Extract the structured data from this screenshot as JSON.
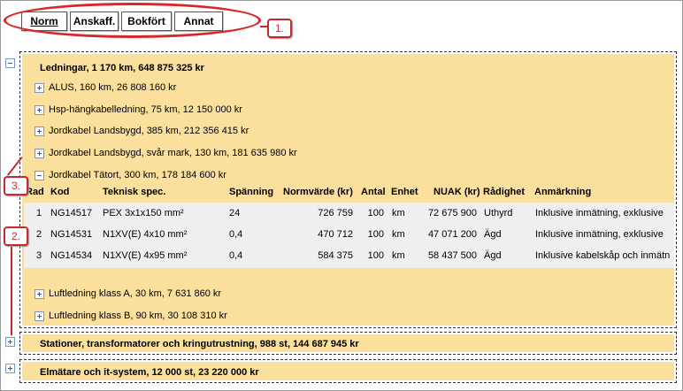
{
  "tabs": [
    {
      "label": "Norm",
      "active": true
    },
    {
      "label": "Anskaff.",
      "active": false
    },
    {
      "label": "Bokfört",
      "active": false
    },
    {
      "label": "Annat",
      "active": false
    }
  ],
  "callouts": {
    "one": "1.",
    "two": "2.",
    "three": "3."
  },
  "groups": {
    "ledningar": {
      "title": "Ledningar, 1 170 km, 648 875 325 kr",
      "expanded": true,
      "items": [
        "ALUS, 160 km, 26 808 160 kr",
        "Hsp-hängkabelledning, 75 km, 12 150 000 kr",
        "Jordkabel Landsbygd, 385 km, 212 356 415 kr",
        "Jordkabel Landsbygd, svår mark, 130 km, 181 635 980 kr",
        "Jordkabel Tätort, 300 km, 178 184 600 kr"
      ],
      "after_items": [
        "Luftledning klass A, 30 km, 7 631 860 kr",
        "Luftledning klass B, 90 km, 30 108 310 kr"
      ]
    },
    "stationer": {
      "title": "Stationer, transformatorer och kringutrustning, 988 st, 144 687 945 kr",
      "expanded": false
    },
    "elmatare": {
      "title": "Elmätare och it-system, 12 000 st, 23 220 000 kr",
      "expanded": false
    }
  },
  "table": {
    "headers": {
      "rad": "Rad",
      "kod": "Kod",
      "spec": "Teknisk spec.",
      "spanning": "Spänning",
      "normvarde": "Normvärde (kr)",
      "antal": "Antal",
      "enhet": "Enhet",
      "nuak": "NUAK (kr)",
      "radighet": "Rådighet",
      "anm": "Anmärkning"
    },
    "rows": [
      {
        "rad": "1",
        "kod": "NG14517",
        "spec": "PEX 3x1x150 mm²",
        "spanning": "24",
        "normvarde": "726 759",
        "antal": "100",
        "enhet": "km",
        "nuak": "72 675 900",
        "radighet": "Uthyrd",
        "anm": "Inklusive inmätning, exklusive"
      },
      {
        "rad": "2",
        "kod": "NG14531",
        "spec": "N1XV(E) 4x10 mm²",
        "spanning": "0,4",
        "normvarde": "470 712",
        "antal": "100",
        "enhet": "km",
        "nuak": "47 071 200",
        "radighet": "Ägd",
        "anm": "Inklusive inmätning, exklusive"
      },
      {
        "rad": "3",
        "kod": "NG14534",
        "spec": "N1XV(E) 4x95 mm²",
        "spanning": "0,4",
        "normvarde": "584 375",
        "antal": "100",
        "enhet": "km",
        "nuak": "58 437 500",
        "radighet": "Ägd",
        "anm": "Inklusive kabelskåp och inmätn"
      }
    ]
  },
  "icons": {
    "expand": "plus-box-icon",
    "collapse": "minus-box-icon"
  },
  "colors": {
    "group_bg": "#fbdf9d",
    "table_body": "#efefef",
    "callout": "#c9282c"
  }
}
